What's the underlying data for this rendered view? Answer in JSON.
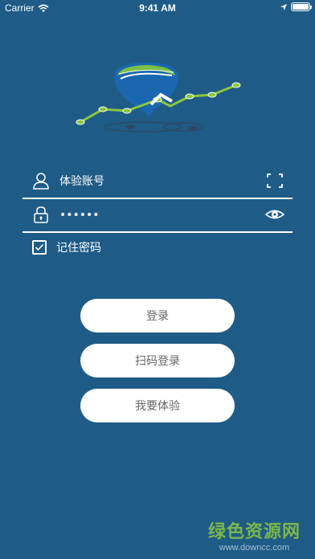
{
  "status_bar": {
    "carrier": "Carrier",
    "time": "9:41 AM",
    "battery_level": 1.0
  },
  "login_form": {
    "account_placeholder": "体验账号",
    "password_value": "123456",
    "remember_label": "记住密码",
    "remember_checked": true
  },
  "buttons": {
    "login": "登录",
    "scan_login": "扫码登录",
    "try": "我要体验"
  },
  "watermark": {
    "main": "绿色资源网",
    "sub": "www.downcc.com"
  },
  "colors": {
    "background": "#1e5c87",
    "logo_green": "#8cc63f",
    "button_text": "#666666"
  }
}
